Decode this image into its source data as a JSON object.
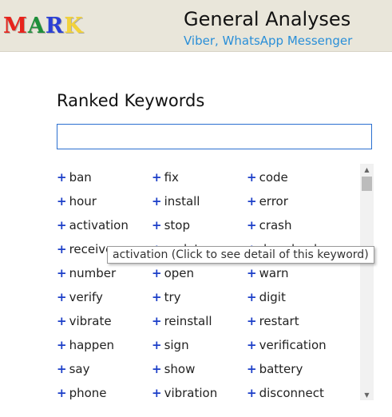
{
  "header": {
    "logo_letters": [
      {
        "char": "M",
        "color": "#e8231c"
      },
      {
        "char": "A",
        "color": "#1e8f3a"
      },
      {
        "char": "R",
        "color": "#2a3fd6"
      },
      {
        "char": "K",
        "color": "#f2d23a"
      }
    ],
    "title": "General Analyses",
    "subtitle": "Viber, WhatsApp Messenger"
  },
  "main": {
    "section_title": "Ranked Keywords",
    "search": {
      "value": "",
      "placeholder": ""
    }
  },
  "keywords": {
    "columns": [
      [
        "ban",
        "hour",
        "activation",
        "receive",
        "number",
        "verify",
        "vibrate",
        "happen",
        "say",
        "phone"
      ],
      [
        "fix",
        "install",
        "stop",
        "update",
        "open",
        "try",
        "reinstall",
        "sign",
        "show",
        "vibration"
      ],
      [
        "code",
        "error",
        "crash",
        "download",
        "warn",
        "digit",
        "restart",
        "verification",
        "battery",
        "disconnect"
      ]
    ]
  },
  "tooltip": {
    "text": "activation (Click to see detail of this keyword)"
  },
  "colors": {
    "header_bg": "#e9e6da",
    "accent": "#2a8fd8",
    "plus": "#1c3fc8",
    "search_border": "#2b6fd0"
  },
  "icons": {
    "scroll_up": "triangle-up-icon",
    "scroll_down": "triangle-down-icon",
    "plus": "plus-icon"
  }
}
